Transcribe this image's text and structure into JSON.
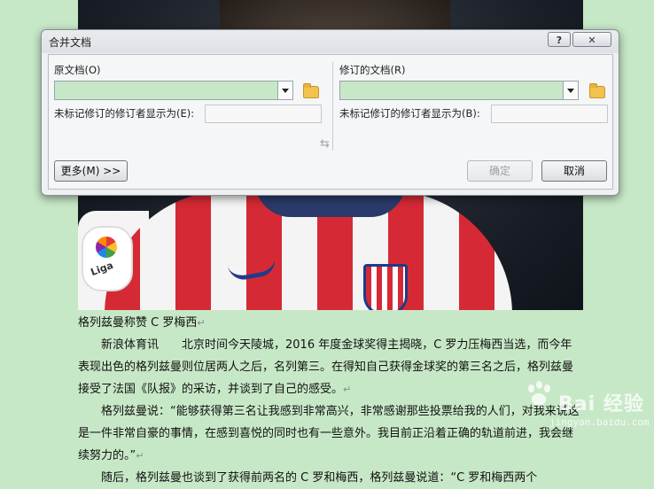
{
  "dialog": {
    "title": "合并文档",
    "help_label": "?",
    "close_label": "✕",
    "original": {
      "label": "原文档(O)",
      "combo_value": "",
      "mark_label": "未标记修订的修订者显示为(E):",
      "mark_value": ""
    },
    "revised": {
      "label": "修订的文档(R)",
      "combo_value": "",
      "mark_label": "未标记修订的修订者显示为(B):",
      "mark_value": ""
    },
    "swap_glyph": "⇆",
    "more_button": "更多(M) >>",
    "ok_button": "确定",
    "cancel_button": "取消"
  },
  "document": {
    "heading": "格列兹曼称赞 C 罗梅西",
    "paragraphs": [
      "新浪体育讯　　北京时间今天陵城，2016 年度金球奖得主揭晓，C 罗力压梅西当选，而今年表现出色的格列兹曼则位居两人之后，名列第三。在得知自己获得金球奖的第三名之后，格列兹曼接受了法国《队报》的采访，并谈到了自己的感受。",
      "格列兹曼说：“能够获得第三名让我感到非常高兴，非常感谢那些投票给我的人们，对我来说这是一件非常自豪的事情，在感到喜悦的同时也有一些意外。我目前正沿着正确的轨道前进，我会继续努力的。”",
      "随后，格列兹曼也谈到了获得前两名的 C 罗和梅西，格列兹曼说道：“C 罗和梅西两个"
    ],
    "paragraph_mark": "↵"
  },
  "photo": {
    "liga_badge_text": "Liga"
  },
  "watermark": {
    "text": "Bai 经验",
    "sub": "jingyan.baidu.com"
  },
  "colors": {
    "page_background": "#c7e8c7",
    "dialog_background": "#eef0f2"
  }
}
